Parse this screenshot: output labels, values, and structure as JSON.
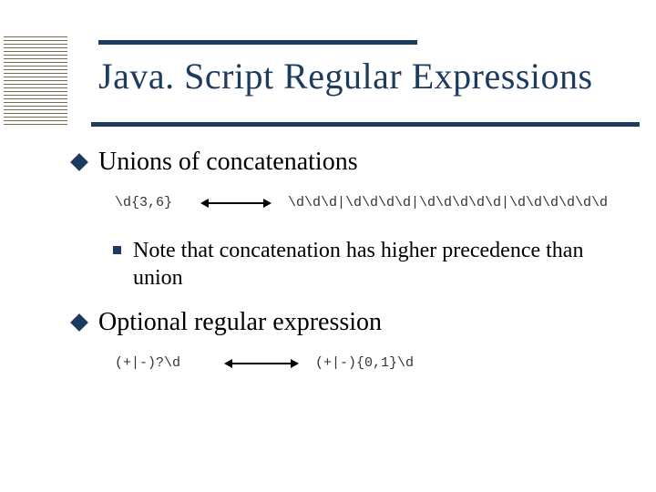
{
  "title": "Java. Script Regular Expressions",
  "bullets": {
    "b1": "Unions of concatenations",
    "b2": "Note that concatenation has higher precedence than union",
    "b3": "Optional regular expression"
  },
  "code": {
    "row1_left": "\\d{3,6}",
    "row1_right": "\\d\\d\\d|\\d\\d\\d\\d|\\d\\d\\d\\d\\d|\\d\\d\\d\\d\\d\\d",
    "row2_left": "(+|-)?\\d",
    "row2_right": "(+|-){0,1}\\d"
  }
}
